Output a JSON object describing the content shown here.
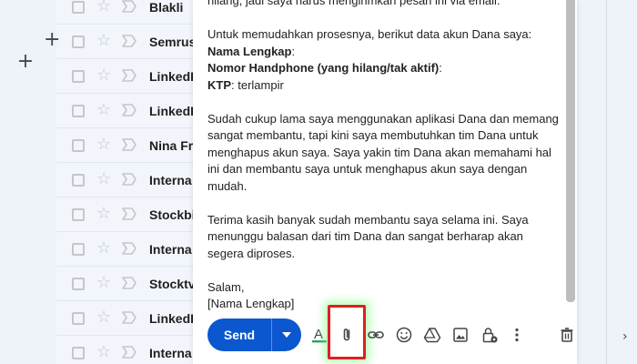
{
  "inbox": {
    "rows": [
      {
        "sender": "Blakli"
      },
      {
        "sender": "Semrus"
      },
      {
        "sender": "LinkedI"
      },
      {
        "sender": "LinkedI"
      },
      {
        "sender": "Nina Fr"
      },
      {
        "sender": "Interna"
      },
      {
        "sender": "Stockbi"
      },
      {
        "sender": "Interna"
      },
      {
        "sender": "Stocktv"
      },
      {
        "sender": "LinkedI"
      },
      {
        "sender": "Interna"
      }
    ]
  },
  "compose": {
    "p0": "hilang, jadi saya harus mengirimkan pesan ini via email.",
    "p1": "Untuk memudahkan prosesnya, berikut data akun Dana saya:",
    "nama_label": "Nama Lengkap",
    "nama_colon": ":",
    "nomor_label": "Nomor Handphone (yang hilang/tak aktif)",
    "nomor_colon": ":",
    "ktp_label": "KTP",
    "ktp_value": ": terlampir",
    "p2": "Sudah cukup lama saya menggunakan aplikasi Dana dan memang sangat membantu, tapi kini saya membutuhkan tim Dana untuk menghapus akun saya. Saya yakin tim Dana akan memahami hal ini dan membantu saya untuk menghapus akun saya dengan mudah.",
    "p3": "Terima kasih banyak sudah membantu saya selama ini. Saya menunggu balasan dari tim Dana dan sangat berharap akan segera diproses.",
    "closing": "Salam,",
    "signature": "[Nama Lengkap]"
  },
  "toolbar": {
    "send_label": "Send",
    "icons": [
      "format-text-icon",
      "attach-icon",
      "link-icon",
      "emoji-icon",
      "drive-icon",
      "photo-icon",
      "lock-icon",
      "more-options-icon",
      "trash-icon"
    ],
    "highlighted": "attach-icon"
  },
  "colors": {
    "accent": "#0b57d0",
    "highlight_border": "#e01f1f",
    "highlight_glow": "#78ff78"
  }
}
